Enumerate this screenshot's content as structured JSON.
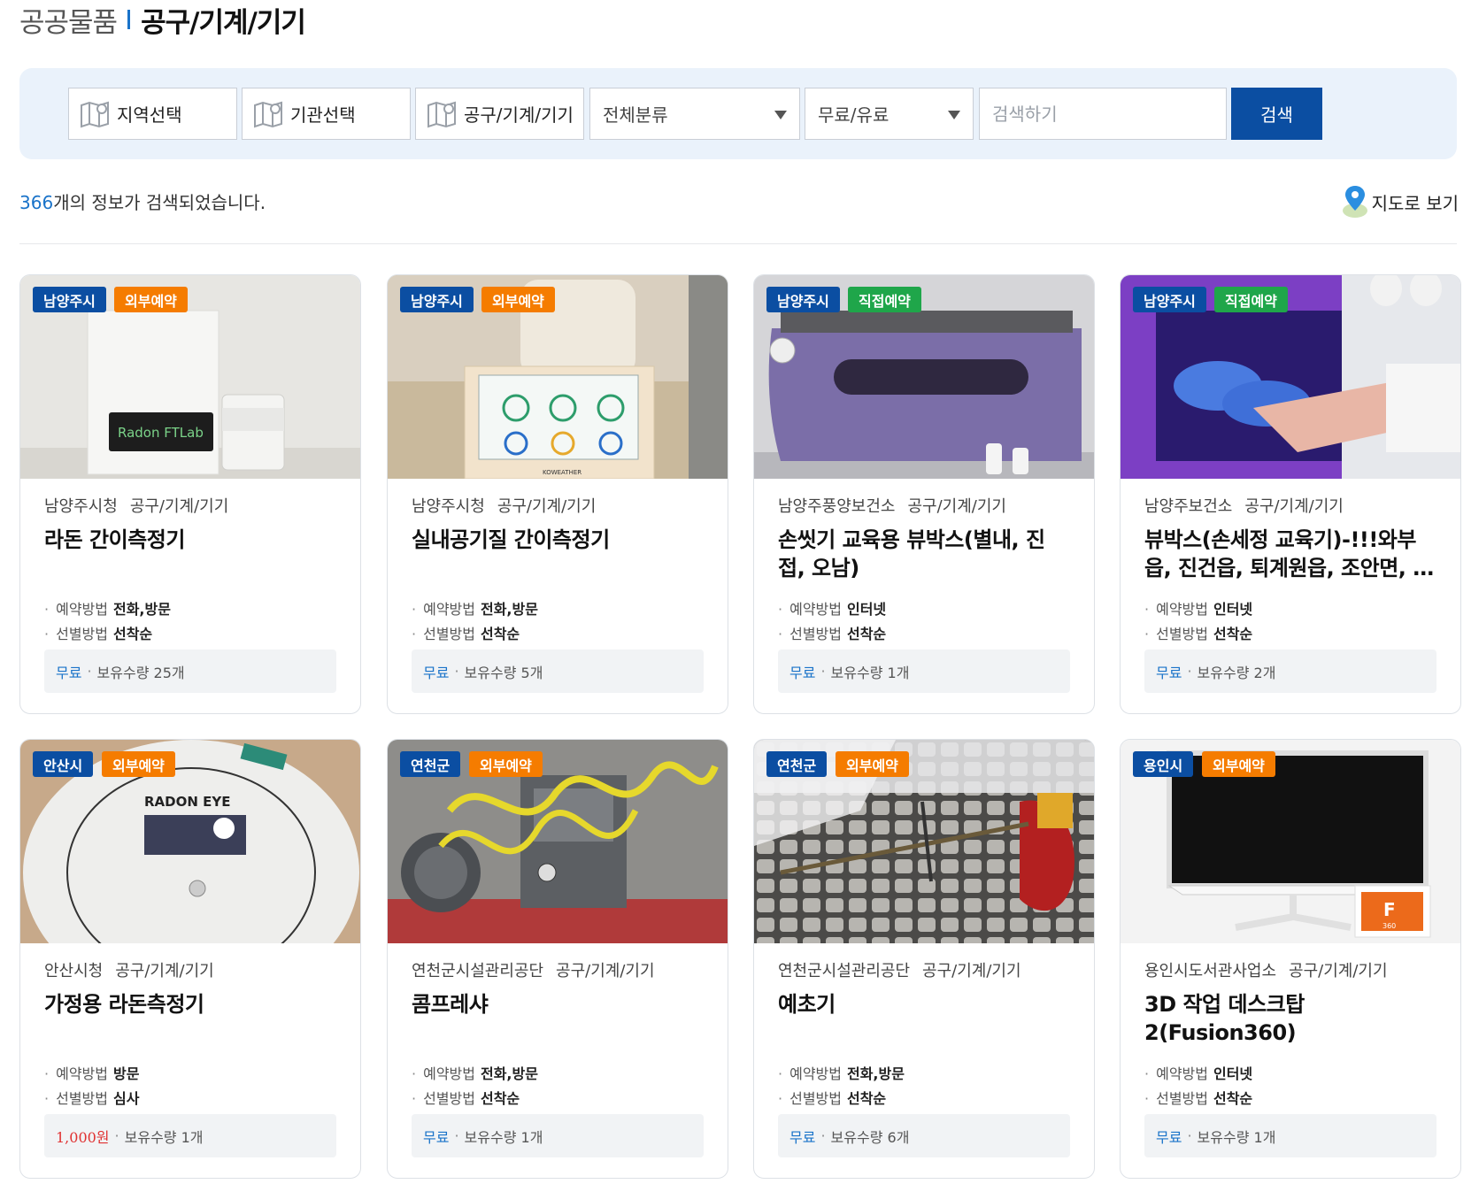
{
  "header": {
    "category": "공공물품",
    "subcategory": "공구/기계/기기"
  },
  "filters": {
    "region": "지역선택",
    "agency": "기관선택",
    "type": "공구/기계/기기",
    "classification": "전체분류",
    "fee": "무료/유료",
    "search_placeholder": "검색하기",
    "search_button": "검색"
  },
  "results": {
    "count": "366",
    "suffix": "개의 정보가 검색되었습니다.",
    "map_view": "지도로 보기"
  },
  "labels": {
    "reserve_method": "예약방법",
    "select_method": "선별방법",
    "quantity": "보유수량"
  },
  "colors": {
    "primary": "#0b4ea2",
    "accent_blue": "#1a73c9",
    "external_badge": "#f57c00",
    "direct_badge": "#1fa64a",
    "price_red": "#e03131"
  },
  "cards": [
    {
      "region": "남양주시",
      "booking": "외부예약",
      "org": "남양주시청",
      "category": "공구/기계/기기",
      "title": "라돈 간이측정기",
      "reserve": "전화,방문",
      "select": "선착순",
      "price": "무료",
      "qty": "25개"
    },
    {
      "region": "남양주시",
      "booking": "외부예약",
      "org": "남양주시청",
      "category": "공구/기계/기기",
      "title": "실내공기질 간이측정기",
      "reserve": "전화,방문",
      "select": "선착순",
      "price": "무료",
      "qty": "5개"
    },
    {
      "region": "남양주시",
      "booking": "직접예약",
      "org": "남양주풍양보건소",
      "category": "공구/기계/기기",
      "title": "손씻기 교육용 뷰박스(별내, 진접, 오남)",
      "reserve": "인터넷",
      "select": "선착순",
      "price": "무료",
      "qty": "1개"
    },
    {
      "region": "남양주시",
      "booking": "직접예약",
      "org": "남양주보건소",
      "category": "공구/기계/기기",
      "title": "뷰박스(손세정 교육기)-!!!와부읍, 진건읍, 퇴계원읍, 조안면, 화도읍",
      "reserve": "인터넷",
      "select": "선착순",
      "price": "무료",
      "qty": "2개"
    },
    {
      "region": "안산시",
      "booking": "외부예약",
      "org": "안산시청",
      "category": "공구/기계/기기",
      "title": "가정용 라돈측정기",
      "reserve": "방문",
      "select": "심사",
      "price": "1,000원",
      "qty": "1개"
    },
    {
      "region": "연천군",
      "booking": "외부예약",
      "org": "연천군시설관리공단",
      "category": "공구/기계/기기",
      "title": "콤프레샤",
      "reserve": "전화,방문",
      "select": "선착순",
      "price": "무료",
      "qty": "1개"
    },
    {
      "region": "연천군",
      "booking": "외부예약",
      "org": "연천군시설관리공단",
      "category": "공구/기계/기기",
      "title": "예초기",
      "reserve": "전화,방문",
      "select": "선착순",
      "price": "무료",
      "qty": "6개"
    },
    {
      "region": "용인시",
      "booking": "외부예약",
      "org": "용인시도서관사업소",
      "category": "공구/기계/기기",
      "title": "3D 작업 데스크탑2(Fusion360)",
      "reserve": "인터넷",
      "select": "선착순",
      "price": "무료",
      "qty": "1개"
    }
  ],
  "image_text": {
    "radon_brand": "Radon FTLab",
    "device_brand": "RADON EYE",
    "weather_brand": "KOWEATHER",
    "fusion_logo": "F",
    "fusion_sub": "360"
  }
}
